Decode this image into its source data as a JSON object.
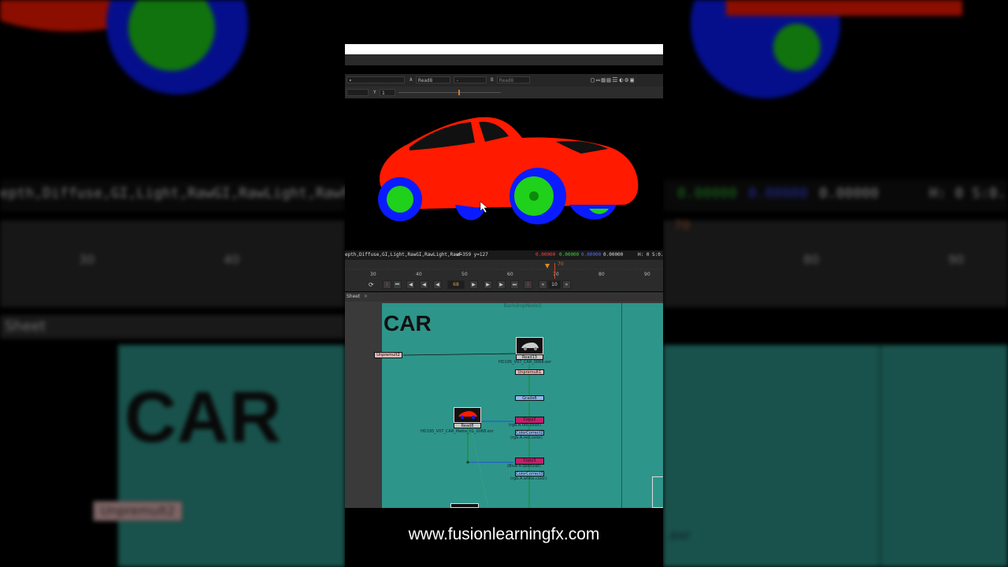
{
  "viewer": {
    "input_a_letter": "A",
    "input_a": "Read8",
    "operation": "-",
    "input_b_letter": "B",
    "input_b": "Read8",
    "y_label": "Y",
    "y_value": "1"
  },
  "info_bar": {
    "channels": "epth,Diffuse,GI,Light,RawGI,RawLight,RawF",
    "coords": "x=359 y=127",
    "r": "0.00000",
    "g": "0.00000",
    "b": "0.00000",
    "a": "0.00000",
    "hs": "H: 0 S:0."
  },
  "timeline": {
    "ticks": [
      "30",
      "40",
      "50",
      "60",
      "70",
      "80",
      "90"
    ],
    "current_frame": "68",
    "step": "10",
    "marker_frame": "70"
  },
  "node_graph": {
    "tab_label": "Sheet",
    "backdrop_label": "BackdropNode3",
    "backdrop_title": "CAR",
    "nodes": {
      "unpremult2": "Unpremult2",
      "read13": "Read13",
      "read13_file": "HD195_V07_CAR_0068.exr",
      "unpremult1": "Unpremult1",
      "grade": "Grade6",
      "copy2": "Copy2",
      "copy2_sub": "(rgb.A.red.color)",
      "colorcorrect2": "ColorCorrect2",
      "colorcorrect2_sub": "(rgb.A.red.color)",
      "read8": "Read8",
      "read8_file": "HD195_V07_CAR_Matte_01_0068.exr",
      "copy3": "Copy3",
      "copy3_sub": "(Blue.A.specular)",
      "colorcorrect3": "ColorCorrect3",
      "colorcorrect3_sub": "(rgb.A.white.color)"
    }
  },
  "background": {
    "left_channels": "epth,Diffuse,GI,Light,RawGI,RawLight,RawF",
    "right_values": [
      "0.00000",
      "0.00000",
      "0.00000"
    ],
    "right_hs": "H: 0 S:0.",
    "left_ticks": [
      "30",
      "40"
    ],
    "right_ticks": [
      "80",
      "90"
    ],
    "right_marker": "70",
    "sheet": "Sheet",
    "car": "CAR",
    "unpremult": "Unpremult2",
    "exr": ".exr"
  },
  "footer": {
    "url": "www.fusionlearningfx.com"
  },
  "colors": {
    "car_body": "#ff1a00",
    "wheel": "#1fd11a",
    "tire": "#0a1cff",
    "backdrop": "#2e958a",
    "copy_node": "#c0206a",
    "cc_node": "#8fb6e8",
    "grade_node": "#8fb6e8"
  }
}
